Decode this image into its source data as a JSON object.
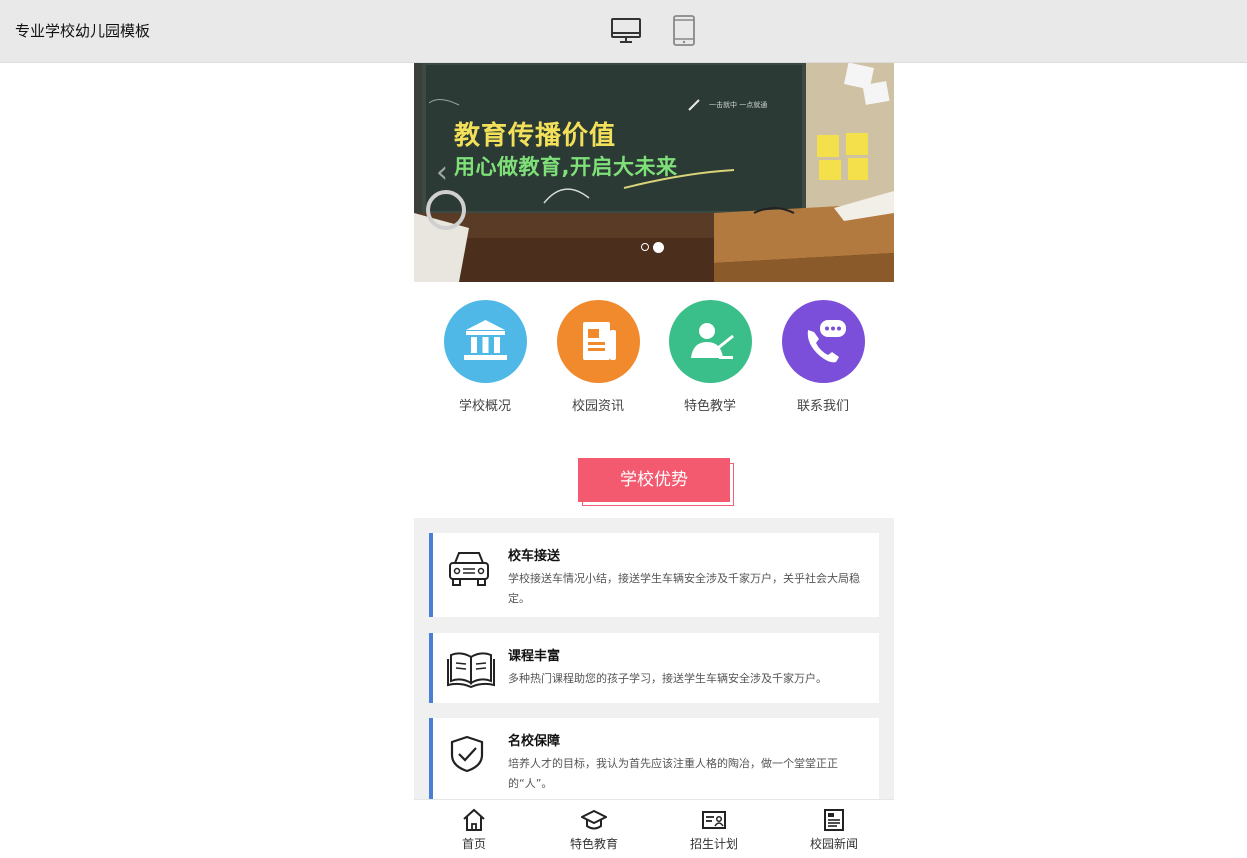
{
  "header": {
    "site_title": "专业学校幼儿园模板",
    "desktop_view_icon": "desktop-monitor-icon",
    "mobile_view_icon": "tablet-device-icon"
  },
  "banner": {
    "subtitle": "一击就中 一点就通",
    "title": "教育传播价值",
    "tagline": "用心做教育,开启大未来",
    "prev_arrow": "‹",
    "slides_count": 2,
    "active_slide": 2
  },
  "quick_nav": [
    {
      "label": "学校概况",
      "icon": "school-building-icon",
      "color": "#4fb8e6"
    },
    {
      "label": "校园资讯",
      "icon": "news-document-icon",
      "color": "#f08a2c"
    },
    {
      "label": "特色教学",
      "icon": "teacher-board-icon",
      "color": "#3bbf8a"
    },
    {
      "label": "联系我们",
      "icon": "phone-chat-icon",
      "color": "#7b4fd9"
    }
  ],
  "advantages": {
    "heading": "学校优势",
    "items": [
      {
        "title": "校车接送",
        "desc": "学校接送车情况小结，接送学生车辆安全涉及千家万户，关乎社会大局稳定。",
        "icon": "school-bus-icon"
      },
      {
        "title": "课程丰富",
        "desc": "多种热门课程助您的孩子学习，接送学生车辆安全涉及千家万户。",
        "icon": "open-book-icon"
      },
      {
        "title": "名校保障",
        "desc": "培养人才的目标，我认为首先应该注重人格的陶冶，做一个堂堂正正的“人”。",
        "icon": "shield-check-icon"
      }
    ]
  },
  "bottom_nav": [
    {
      "label": "首页",
      "icon": "home-icon"
    },
    {
      "label": "特色教育",
      "icon": "graduation-cap-icon"
    },
    {
      "label": "招生计划",
      "icon": "enrollment-card-icon"
    },
    {
      "label": "校园新闻",
      "icon": "newspaper-icon"
    }
  ],
  "colors": {
    "accent_pink": "#f3596f",
    "accent_blue": "#4a7fd6",
    "topbar_bg": "#e9e9e9"
  }
}
